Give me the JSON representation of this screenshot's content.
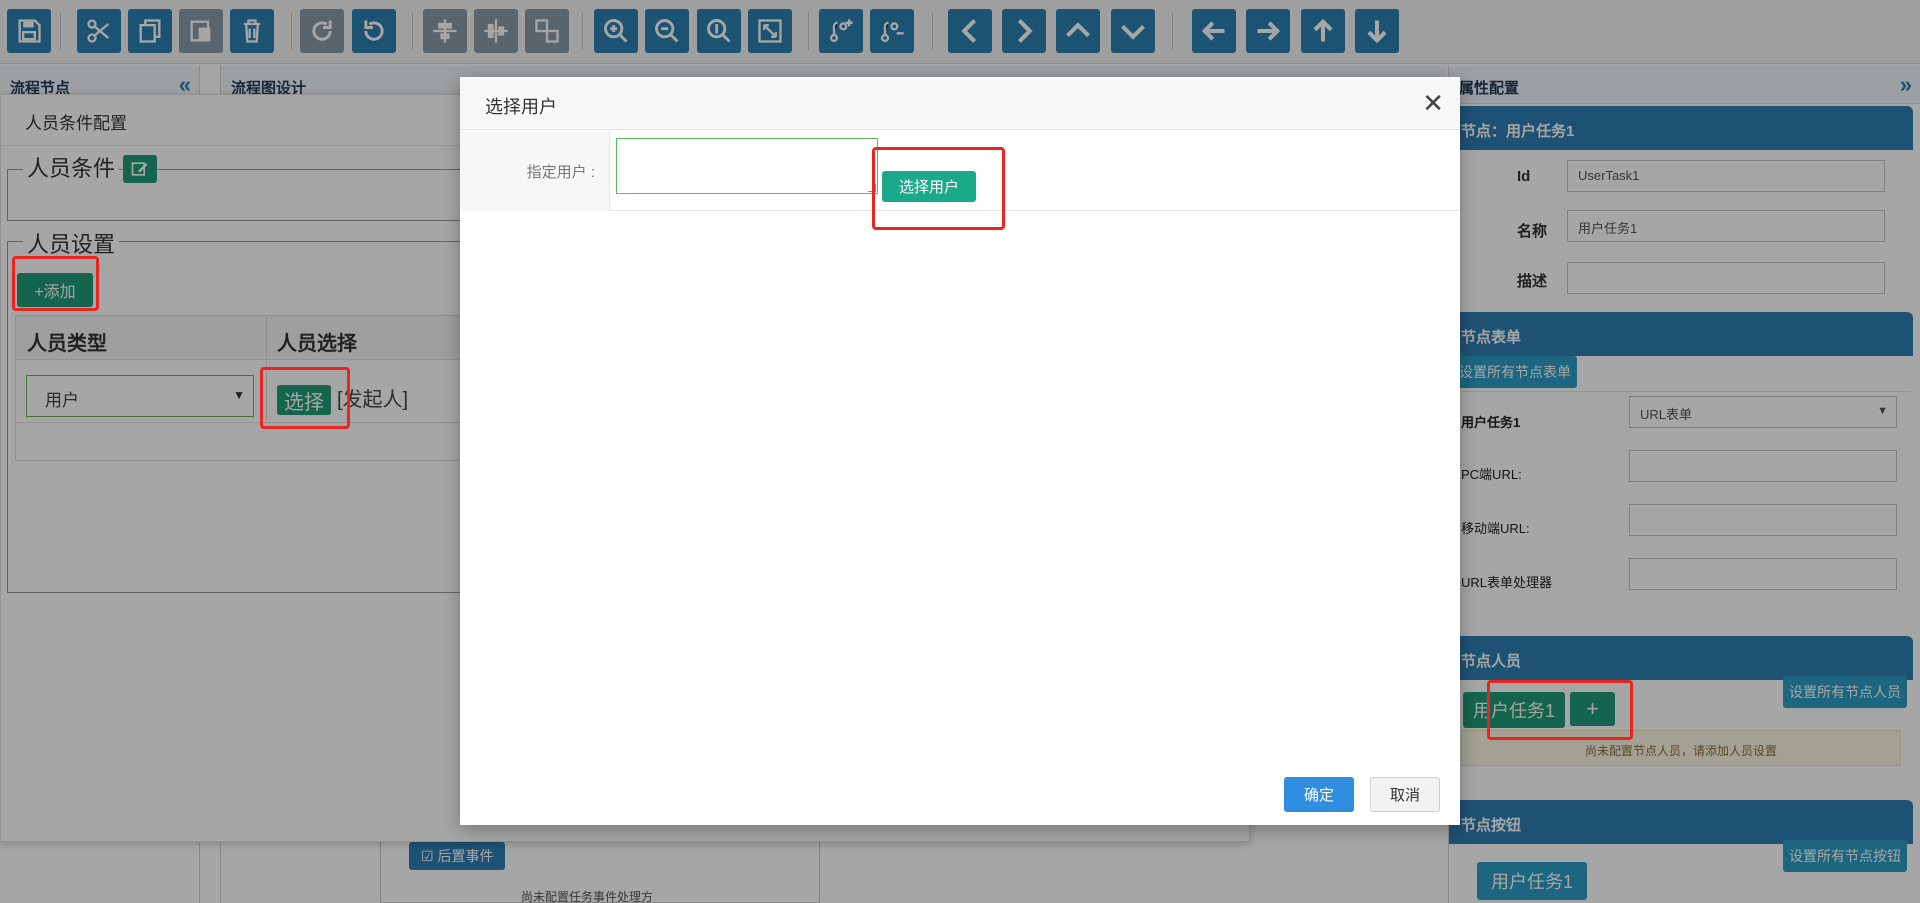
{
  "toolbar": {
    "icons": [
      "save-icon",
      "cut-icon",
      "copy-icon",
      "paste-icon",
      "delete-icon",
      "redo-icon",
      "undo-icon",
      "align-horizontal-icon",
      "align-vertical-icon",
      "same-size-icon",
      "zoom-in-icon",
      "zoom-out-icon",
      "zoom-reset-icon",
      "fit-icon",
      "add-branch-icon",
      "remove-branch-icon",
      "chevron-left-icon",
      "chevron-right-icon",
      "chevron-up-icon",
      "chevron-down-icon",
      "arrow-left-icon",
      "arrow-right-icon",
      "arrow-up-icon",
      "arrow-down-icon"
    ]
  },
  "left_panel": {
    "title": "流程节点"
  },
  "center_panel": {
    "title": "流程图设计",
    "post_event_label": "后置事件",
    "post_event_note": "尚未配置任务事件处理方"
  },
  "right_panel": {
    "title": "属性配置",
    "node_header": "节点：用户任务1",
    "fields": [
      {
        "label": "Id",
        "value": "UserTask1"
      },
      {
        "label": "名称",
        "value": "用户任务1"
      },
      {
        "label": "描述",
        "value": ""
      }
    ],
    "form_section": {
      "title": "节点表单",
      "set_all_button": "设置所有节点表单",
      "task_label": "用户任务1",
      "form_type_value": "URL表单",
      "pc_url_label": "PC端URL:",
      "mobile_url_label": "移动端URL:",
      "handler_label": "URL表单处理器"
    },
    "people_section": {
      "title": "节点人员",
      "set_all_button": "设置所有节点人员",
      "task_tag": "用户任务1",
      "warning": "尚未配置节点人员，请添加人员设置"
    },
    "button_section": {
      "title": "节点按钮",
      "set_all_button": "设置所有节点按钮",
      "task_tag": "用户任务1"
    }
  },
  "condition_panel": {
    "title": "人员条件配置",
    "conditions_legend": "人员条件",
    "settings_legend": "人员设置",
    "add_button": "+添加",
    "columns": [
      "人员类型",
      "人员选择"
    ],
    "row": {
      "type_value": "用户",
      "select_button": "选择",
      "selected_text": "[发起人]"
    }
  },
  "dialog": {
    "title": "选择用户",
    "field_label": "指定用户 :",
    "textarea_value": "",
    "choose_button": "选择用户",
    "ok_button": "确定",
    "cancel_button": "取消"
  }
}
